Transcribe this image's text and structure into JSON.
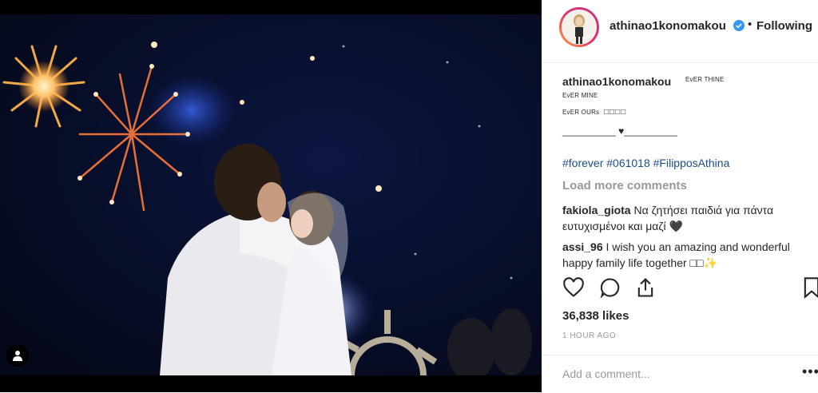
{
  "post": {
    "header": {
      "username": "athinao1konomakou",
      "separator": "•",
      "follow_label": "Following"
    },
    "caption": {
      "username": "athinao1konomakou",
      "line1": "EvER THINE",
      "line2": "EvER MINE",
      "line3": "EvER OURs",
      "line3_boxes": "□□□□",
      "line4": "__________ ♥__________",
      "hashtags": "#forever #061018 #FilipposAthina"
    },
    "load_more": "Load more comments",
    "comments": [
      {
        "user": "fakiola_giota",
        "text": "Να ζητήσει παιδιά για πάντα ευτυχισμένοι και μαζί 🖤"
      },
      {
        "user": "assi_96",
        "text": "I wish you an amazing and wonderful happy family life together □□✨"
      }
    ],
    "likes": "36,838 likes",
    "timestamp": "1 HOUR AGO",
    "add_comment_placeholder": "Add a comment...",
    "more_options": "•••"
  },
  "icons": [
    "user-tag-icon",
    "heart-icon",
    "comment-icon",
    "share-icon",
    "bookmark-icon",
    "verified-badge-icon"
  ],
  "colors": {
    "link": "#1a4f8c",
    "verified": "#3897f0",
    "muted": "#999999",
    "text": "#262626"
  }
}
